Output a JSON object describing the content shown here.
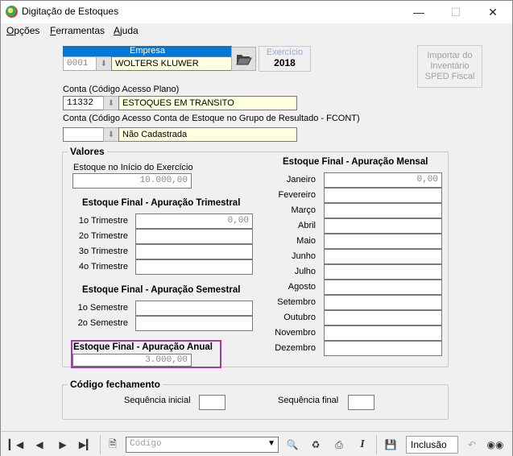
{
  "window": {
    "title": "Digitação de Estoques"
  },
  "menu": {
    "opcoes": "Opções",
    "opcoes_u": "O",
    "opcoes_rest": "pções",
    "ferramentas_u": "F",
    "ferramentas_rest": "erramentas",
    "ajuda_u": "A",
    "ajuda_rest": "juda"
  },
  "empresa": {
    "header": "Empresa",
    "code": "0001",
    "name": "WOLTERS KLUWER"
  },
  "exercicio": {
    "label": "Exercício",
    "value": "2018"
  },
  "importar": {
    "label": "Importar do Inventário SPED Fiscal"
  },
  "conta": {
    "label": "Conta (Código Acesso Plano)",
    "code": "11332",
    "name": "ESTOQUES EM TRANSITO"
  },
  "conta_fcont": {
    "label": "Conta (Código Acesso Conta de Estoque no Grupo de Resultado - FCONT)",
    "code": "",
    "name": "Não Cadastrada"
  },
  "valores": {
    "title": "Valores",
    "inicio_label": "Estoque no Início do Exercício",
    "inicio_value": "10.000,00",
    "trimestral_title": "Estoque Final - Apuração Trimestral",
    "trimestres": [
      {
        "label": "1o Trimestre",
        "value": "0,00"
      },
      {
        "label": "2o Trimestre",
        "value": ""
      },
      {
        "label": "3o Trimestre",
        "value": ""
      },
      {
        "label": "4o Trimestre",
        "value": ""
      }
    ],
    "semestral_title": "Estoque Final - Apuração Semestral",
    "semestres": [
      {
        "label": "1o Semestre",
        "value": ""
      },
      {
        "label": "2o Semestre",
        "value": ""
      }
    ],
    "anual_title": "Estoque Final - Apuração Anual",
    "anual_value": "3.000,00",
    "mensal_title": "Estoque Final - Apuração Mensal",
    "meses": [
      {
        "label": "Janeiro",
        "value": "0,00"
      },
      {
        "label": "Fevereiro",
        "value": ""
      },
      {
        "label": "Março",
        "value": ""
      },
      {
        "label": "Abril",
        "value": ""
      },
      {
        "label": "Maio",
        "value": ""
      },
      {
        "label": "Junho",
        "value": ""
      },
      {
        "label": "Julho",
        "value": ""
      },
      {
        "label": "Agosto",
        "value": ""
      },
      {
        "label": "Setembro",
        "value": ""
      },
      {
        "label": "Outubro",
        "value": ""
      },
      {
        "label": "Novembro",
        "value": ""
      },
      {
        "label": "Dezembro",
        "value": ""
      }
    ]
  },
  "fechamento": {
    "title": "Código fechamento",
    "inicial_label": "Sequência inicial",
    "final_label": "Sequência final",
    "inicial_value": "",
    "final_value": ""
  },
  "toolbar": {
    "codigo_placeholder": "Código",
    "mode": "Inclusão"
  },
  "colors": {
    "highlight_border": "#9b3fa0",
    "empresa_header": "#0078d7",
    "yellow_field": "#ffffe1"
  }
}
